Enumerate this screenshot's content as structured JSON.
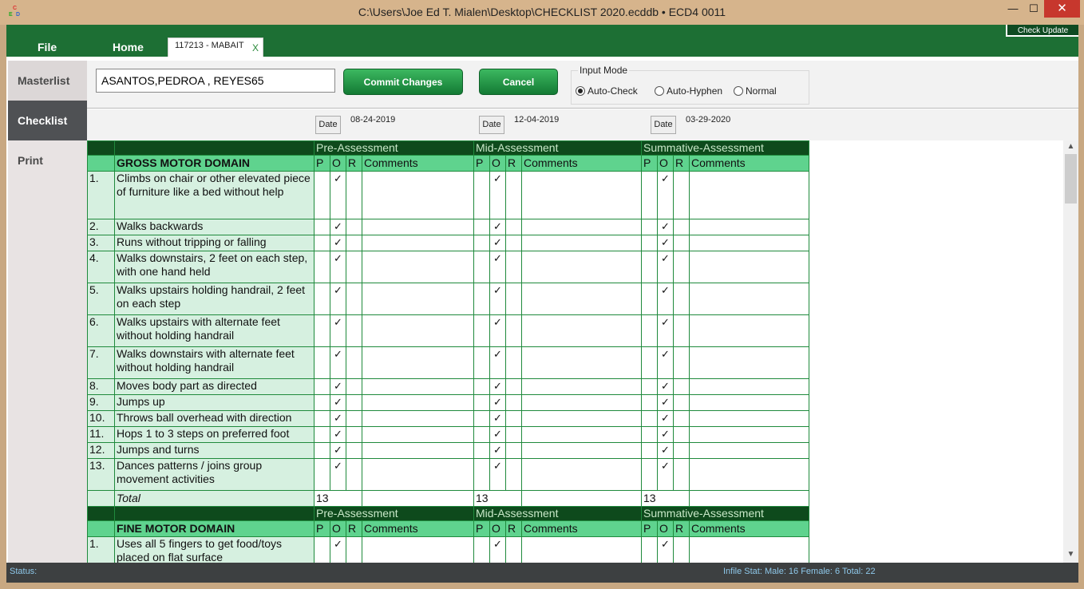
{
  "window": {
    "title": "C:\\Users\\Joe Ed T. Mialen\\Desktop\\CHECKLIST 2020.ecddb  •  ECD4 0011",
    "icon_letters": [
      "C",
      "E",
      "D"
    ],
    "minimize": "—",
    "maximize": "☐",
    "close": "✕"
  },
  "ribbon": {
    "file": "File",
    "home": "Home",
    "doc_tab": "117213 -  MABAIT",
    "doc_tab_close": "X",
    "check_update": "Check Update"
  },
  "sidebar": {
    "masterlist": "Masterlist",
    "checklist": "Checklist",
    "print": "Print"
  },
  "toolbar": {
    "name_value": "ASANTOS,PEDROA , REYES65",
    "commit": "Commit Changes",
    "cancel": "Cancel",
    "input_mode": {
      "legend": "Input Mode",
      "options": [
        "Auto-Check",
        "Auto-Hyphen",
        "Normal"
      ],
      "selected": "Auto-Check"
    }
  },
  "dates": [
    {
      "label": "Date",
      "value": "08-24-2019"
    },
    {
      "label": "Date",
      "value": "12-04-2019"
    },
    {
      "label": "Date",
      "value": "03-29-2020"
    }
  ],
  "table": {
    "phases": [
      "Pre-Assessment",
      "Mid-Assessment",
      "Summative-Assessment"
    ],
    "cols": {
      "p": "P",
      "o": "O",
      "r": "R",
      "comments": "Comments"
    },
    "check": "✓",
    "total_label": "Total",
    "gross": {
      "title": "GROSS MOTOR DOMAIN",
      "items": [
        {
          "n": "1.",
          "t": "Climbs on chair or other elevated piece of furniture like a bed without help"
        },
        {
          "n": "2.",
          "t": "Walks backwards"
        },
        {
          "n": "3.",
          "t": "Runs without tripping or falling"
        },
        {
          "n": "4.",
          "t": "Walks downstairs, 2 feet on each step, with one hand held"
        },
        {
          "n": "5.",
          "t": "Walks upstairs holding handrail, 2 feet on each step"
        },
        {
          "n": "6.",
          "t": "Walks upstairs with alternate feet without holding handrail"
        },
        {
          "n": "7.",
          "t": "Walks downstairs with alternate feet without holding handrail"
        },
        {
          "n": "8.",
          "t": "Moves body part as directed"
        },
        {
          "n": "9.",
          "t": "Jumps up"
        },
        {
          "n": "10.",
          "t": "Throws ball overhead with direction"
        },
        {
          "n": "11.",
          "t": "Hops 1 to 3 steps on preferred foot"
        },
        {
          "n": "12.",
          "t": "Jumps and turns"
        },
        {
          "n": "13.",
          "t": "Dances patterns / joins group movement activities"
        }
      ],
      "totals": [
        "13",
        "13",
        "13"
      ]
    },
    "fine": {
      "title": "FINE MOTOR DOMAIN",
      "items": [
        {
          "n": "1.",
          "t": "Uses all 5 fingers to get food/toys placed on flat surface"
        }
      ]
    }
  },
  "scroll": {
    "up": "▲",
    "down": "▼"
  },
  "status": {
    "label": "Status:",
    "stats": "Infile Stat:  Male: 16  Female: 6   Total: 22"
  }
}
